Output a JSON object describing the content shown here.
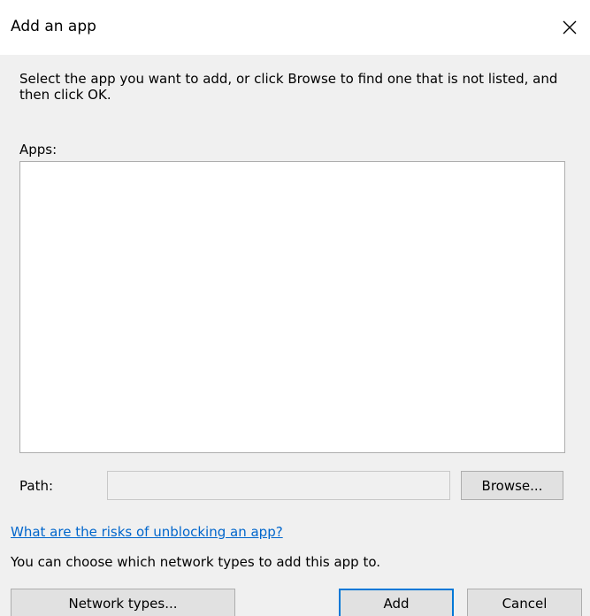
{
  "window": {
    "title": "Add an app",
    "close_icon": "close-icon"
  },
  "instructions": "Select the app you want to add, or click Browse to find one that is not listed, and then click OK.",
  "apps": {
    "label": "Apps:",
    "items": []
  },
  "path": {
    "label": "Path:",
    "value": "",
    "browse_label": "Browse..."
  },
  "risk_link": "What are the risks of unblocking an app?",
  "network_text": "You can choose which network types to add this app to.",
  "buttons": {
    "network_types": "Network types...",
    "add": "Add",
    "cancel": "Cancel"
  },
  "colors": {
    "link": "#0066cc",
    "default_button_border": "#0078d7",
    "panel_background": "#f0f0f0"
  }
}
